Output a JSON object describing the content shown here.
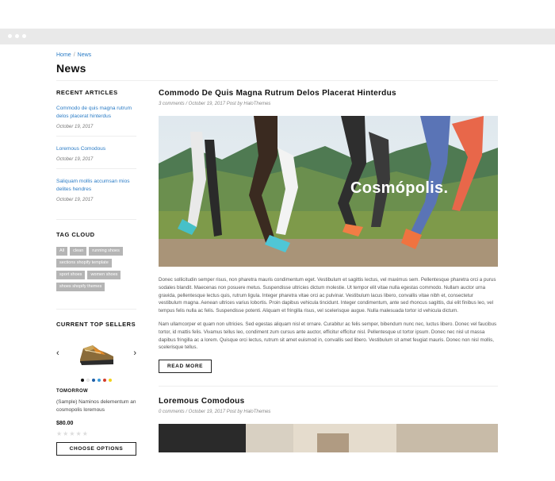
{
  "breadcrumb": {
    "home": "Home",
    "separator": "/",
    "current": "News"
  },
  "page_title": "News",
  "sidebar": {
    "recent_heading": "RECENT ARTICLES",
    "articles": [
      {
        "title": "Commodo de quis magna rutrum delos placerat hinterdus",
        "date": "October 19, 2017"
      },
      {
        "title": "Loremous Comodous",
        "date": "October 19, 2017"
      },
      {
        "title": "Saliquam mollis accumsan mios delites hendres",
        "date": "October 19, 2017"
      }
    ],
    "tag_heading": "TAG CLOUD",
    "tags": [
      "All",
      "clean",
      "running shoes",
      "sections shopify template",
      "sport shoes",
      "women shoes",
      "shoes shopify themes"
    ],
    "sellers_heading": "CURRENT TOP SELLERS",
    "seller": {
      "vendor": "TOMORROW",
      "name": "(Sample) Naminos delementum an cosmopolis loremous",
      "price": "$80.00",
      "stars": "★★★★★",
      "button": "CHOOSE OPTIONS",
      "prev_arrow": "‹",
      "next_arrow": "›",
      "swatch_colors": [
        "#111111",
        "#f0f0f0",
        "#1f5fa8",
        "#3b9ad9",
        "#d43b2a",
        "#f2d21b"
      ]
    }
  },
  "posts": [
    {
      "title": "Commodo De Quis Magna Rutrum Delos Placerat Hinterdus",
      "meta": "3 comments / October 19, 2017 Post by HaloThemes",
      "image_text": "Cosmópolis.",
      "paragraphs": [
        "Donec sollicitudin semper risus, non pharetra mauris condimentum eget. Vestibulum et sagittis lectus, vel maximus sem. Pellentesque pharetra orci a purus sodales blandit. Maecenas non posuere metus. Suspendisse ultricies dictum molestie. Ut tempor elit vitae nulla egestas commodo. Nullam auctor urna gravida, pellentesque lectus quis, rutrum ligula. Integer pharetra vitae orci ac pulvinar. Vestibulum lacus libero, convallis vitae nibh et, consectetur vestibulum magna. Aenean ultrices varius lobortis. Proin dapibus vehicula tincidunt. Integer condimentum, ante sed rhoncus sagittis, dui elit finibus leo, vel tempus felis nulla ac felis. Suspendisse potenti. Aliquam et fringilla risus, vel scelerisque augue. Nulla malesuada tortor id vehicula dictum.",
        "Nam ullamcorper et quam non ultricies. Sed egestas aliquam nisl et ornare. Curabitur ac felis semper, bibendum nunc nec, luctus libero. Donec vel faucibus tortor, id mattis felis. Vivamus tellus leo, condiment zum cursus ante auctor, efficitur efficitur nisl. Pellentesque ut tortor ipsum. Donec nec nisl ut massa dapibus fringilla ac a lorem. Quisque orci lectus, rutrum sit amet euismod in, convallis sed libero. Vestibulum sit amet feugiat mauris. Donec non nisl mollis, scelerisque tellus."
      ],
      "button": "READ MORE"
    },
    {
      "title": "Loremous Comodous",
      "meta": "0 comments / October 19, 2017 Post by HaloThemes"
    }
  ]
}
